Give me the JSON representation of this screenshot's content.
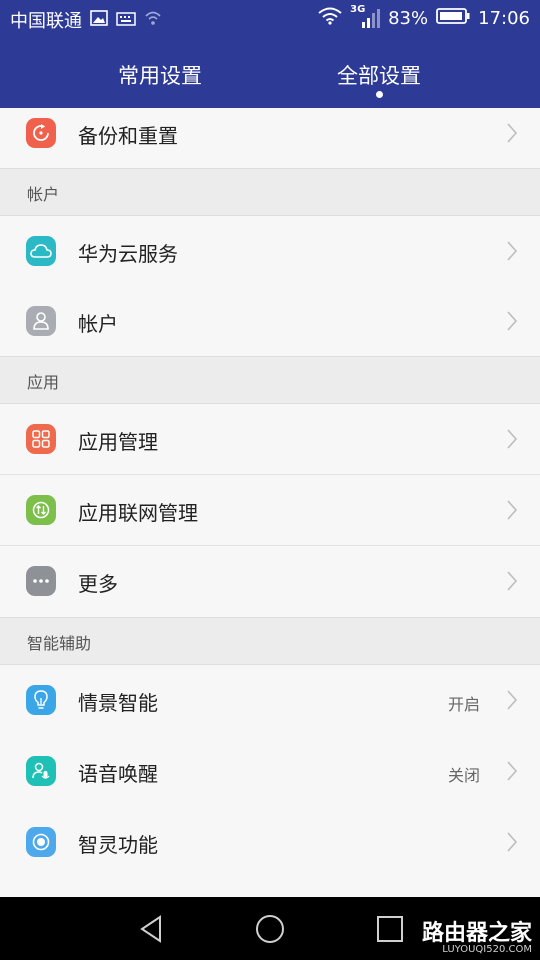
{
  "status_bar": {
    "carrier": "中国联通",
    "network": "3G",
    "battery": "83%",
    "time": "17:06"
  },
  "tabs": [
    {
      "label": "常用设置",
      "active": false
    },
    {
      "label": "全部设置",
      "active": true
    }
  ],
  "top_item": {
    "label": "备份和重置",
    "icon": "backup-reset-icon",
    "color": "#f0614d"
  },
  "sections": [
    {
      "title": "帐户",
      "items": [
        {
          "label": "华为云服务",
          "icon": "cloud-icon",
          "color": "#2ab9c5"
        },
        {
          "label": "帐户",
          "icon": "account-icon",
          "color": "#a9adb3"
        }
      ]
    },
    {
      "title": "应用",
      "items": [
        {
          "label": "应用管理",
          "icon": "apps-grid-icon",
          "color": "#ef6a4c"
        },
        {
          "label": "应用联网管理",
          "icon": "network-arrows-icon",
          "color": "#7cc04b"
        },
        {
          "label": "更多",
          "icon": "more-dots-icon",
          "color": "#8e9297"
        }
      ]
    },
    {
      "title": "智能辅助",
      "items": [
        {
          "label": "情景智能",
          "value": "开启",
          "icon": "lightbulb-icon",
          "color": "#3aa6e8"
        },
        {
          "label": "语音唤醒",
          "value": "关闭",
          "icon": "voice-wake-icon",
          "color": "#1fc1b6"
        },
        {
          "label": "智灵功能",
          "icon": "smart-assist-icon",
          "color": "#4ea8ec"
        }
      ]
    }
  ],
  "watermark": {
    "title": "路由器之家",
    "subtitle": "LUYOUQI520.COM"
  }
}
